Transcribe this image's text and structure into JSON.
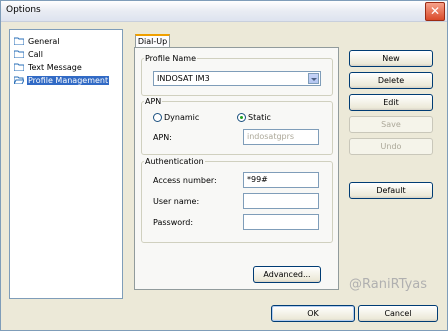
{
  "window": {
    "title": "Options",
    "close_symbol": "✕"
  },
  "tree": {
    "items": [
      {
        "label": "General",
        "icon": "folder-icon",
        "selected": false
      },
      {
        "label": "Call",
        "icon": "folder-icon",
        "selected": false
      },
      {
        "label": "Text Message",
        "icon": "folder-icon",
        "selected": false
      },
      {
        "label": "Profile Management",
        "icon": "folder-open-icon",
        "selected": true
      }
    ]
  },
  "tab": {
    "label": "Dial-Up"
  },
  "profile_name": {
    "legend": "Profile Name",
    "selected": "INDOSAT IM3"
  },
  "apn": {
    "legend": "APN",
    "dynamic_label": "Dynamic",
    "static_label": "Static",
    "selected": "Static",
    "apn_label": "APN:",
    "apn_value": "indosatgprs"
  },
  "authentication": {
    "legend": "Authentication",
    "access_number_label": "Access number:",
    "access_number_value": "*99#",
    "username_label": "User name:",
    "username_value": "",
    "password_label": "Password:",
    "password_value": ""
  },
  "buttons": {
    "new": "New",
    "delete": "Delete",
    "edit": "Edit",
    "save": "Save",
    "undo": "Undo",
    "default": "Default",
    "advanced": "Advanced...",
    "ok": "OK",
    "cancel": "Cancel"
  },
  "watermark": "@RaniRTyas",
  "colors": {
    "selection": "#316ac5",
    "radio_dot": "#21a121",
    "title_close": "#d94a2a"
  }
}
